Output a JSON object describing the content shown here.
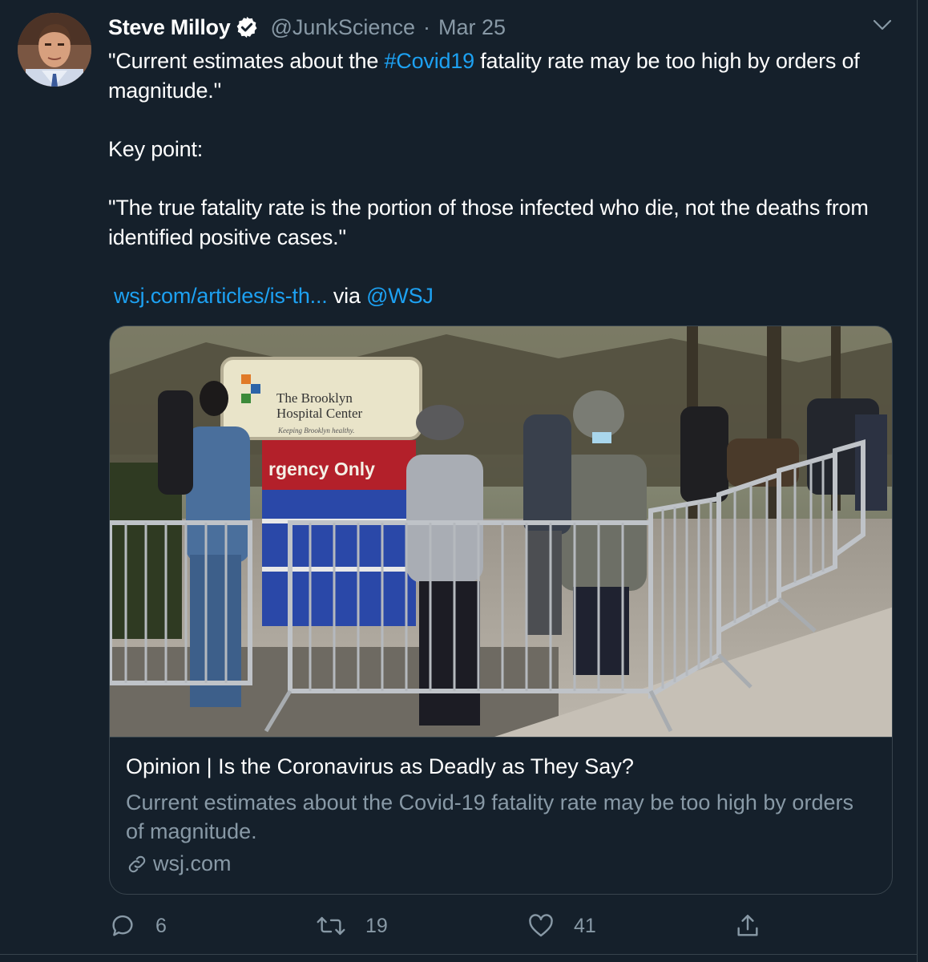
{
  "tweet": {
    "author_name": "Steve Milloy",
    "author_handle": "@JunkScience",
    "separator": "·",
    "date": "Mar 25",
    "line1_pre": "\"Current estimates about the ",
    "hashtag": "#Covid19",
    "line1_post": " fatality rate may be too high by orders of magnitude.\"",
    "key_point": "Key point:",
    "quote": "\"The true fatality rate is the portion of those infected who die, not the deaths from identified positive cases.\"",
    "url_text": "wsj.com/articles/is-th...",
    "via_text": " via ",
    "mention": "@WSJ"
  },
  "card": {
    "title": "Opinion | Is the Coronavirus as Deadly as They Say?",
    "description": "Current estimates about the Covid-19 fatality rate may be too high by orders of magnitude.",
    "domain": "wsj.com",
    "sign_line1": "The Brooklyn",
    "sign_line2": "Hospital Center",
    "sign_tagline": "Keeping Brooklyn healthy.",
    "sign_banner": "rgency Only"
  },
  "actions": {
    "reply_count": "6",
    "retweet_count": "19",
    "like_count": "41"
  },
  "colors": {
    "background": "#15202b",
    "link": "#1da1f2",
    "secondary_text": "#8899a6",
    "border": "#38444d"
  },
  "icons": [
    "verified-badge-icon",
    "chevron-down-icon",
    "link-icon",
    "reply-icon",
    "retweet-icon",
    "like-icon",
    "share-icon"
  ]
}
